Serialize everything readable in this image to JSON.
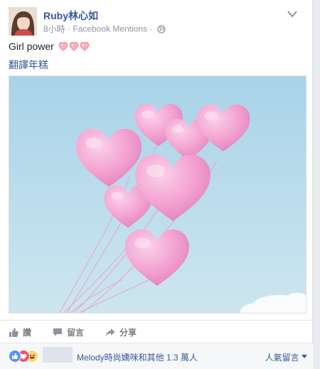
{
  "post": {
    "author": "Ruby林心如",
    "time": "8小時",
    "separator": "·",
    "source": "Facebook Mentions",
    "text": "Girl power",
    "translate_link": "翻譯年糕",
    "photo_icon": "pink-heart-balloons-photo"
  },
  "actions": {
    "like": "讚",
    "comment": "留言",
    "share": "分享"
  },
  "social": {
    "likers_text": "Melody時尚嬌咪和其他 1.3 萬人",
    "sort_label": "人氣留言",
    "reaction_icons": [
      "like-icon",
      "love-icon",
      "haha-icon"
    ]
  },
  "colors": {
    "link": "#365899",
    "like_blue": "#5890ff",
    "love_red": "#f25268",
    "haha_yellow": "#fcd669",
    "balloon_pink": "#f5a7d4",
    "sky": "#b9dcec"
  }
}
